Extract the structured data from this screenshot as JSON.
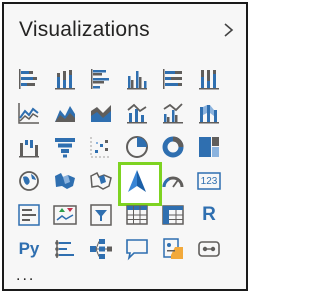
{
  "pane": {
    "title": "Visualizations",
    "collapse_icon": "chevron-right-icon",
    "more_label": "..."
  },
  "visuals": [
    {
      "icon": "stacked-bar-chart-icon"
    },
    {
      "icon": "stacked-column-chart-icon"
    },
    {
      "icon": "clustered-bar-chart-icon"
    },
    {
      "icon": "clustered-column-chart-icon"
    },
    {
      "icon": "100-stacked-bar-chart-icon"
    },
    {
      "icon": "100-stacked-column-chart-icon"
    },
    {
      "icon": "line-chart-icon"
    },
    {
      "icon": "area-chart-icon"
    },
    {
      "icon": "stacked-area-chart-icon"
    },
    {
      "icon": "line-and-stacked-column-chart-icon"
    },
    {
      "icon": "line-and-clustered-column-chart-icon"
    },
    {
      "icon": "ribbon-chart-icon"
    },
    {
      "icon": "waterfall-chart-icon"
    },
    {
      "icon": "funnel-chart-icon"
    },
    {
      "icon": "scatter-chart-icon"
    },
    {
      "icon": "pie-chart-icon"
    },
    {
      "icon": "donut-chart-icon"
    },
    {
      "icon": "treemap-icon"
    },
    {
      "icon": "map-icon"
    },
    {
      "icon": "filled-map-icon"
    },
    {
      "icon": "shape-map-icon"
    },
    {
      "icon": "azure-map-icon",
      "selected": true
    },
    {
      "icon": "gauge-icon"
    },
    {
      "icon": "card-icon",
      "text": "123"
    },
    {
      "icon": "multi-row-card-icon"
    },
    {
      "icon": "kpi-icon"
    },
    {
      "icon": "slicer-icon"
    },
    {
      "icon": "table-icon"
    },
    {
      "icon": "matrix-icon"
    },
    {
      "icon": "r-script-visual-icon",
      "text": "R"
    },
    {
      "icon": "python-visual-icon",
      "text": "Py"
    },
    {
      "icon": "key-influencers-icon"
    },
    {
      "icon": "decomposition-tree-icon"
    },
    {
      "icon": "qa-icon"
    },
    {
      "icon": "smart-narrative-icon"
    },
    {
      "icon": "paginated-report-icon"
    }
  ],
  "colors": {
    "accent_blue": "#2f6fb0",
    "dark_gray": "#605e5c",
    "selected_outline": "#7ed321"
  }
}
